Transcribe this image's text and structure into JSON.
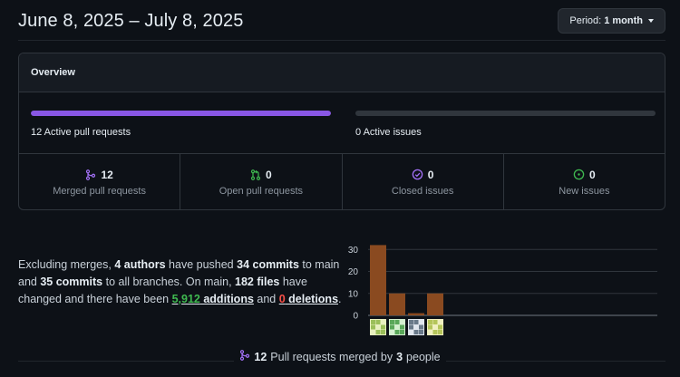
{
  "header": {
    "title": "June 8, 2025 – July 8, 2025",
    "period_prefix": "Period:",
    "period_value": "1 month"
  },
  "overview": {
    "title": "Overview",
    "pr_progress_fraction": 1.0,
    "issues_progress_fraction": 0.0,
    "active_prs_label": "12 Active pull requests",
    "active_issues_label": "0 Active issues",
    "stats": [
      {
        "icon": "git-merge-icon",
        "count": "12",
        "label": "Merged pull requests",
        "color": "#a371f7"
      },
      {
        "icon": "git-pull-request-icon",
        "count": "0",
        "label": "Open pull requests",
        "color": "#3fb950"
      },
      {
        "icon": "issue-closed-icon",
        "count": "0",
        "label": "Closed issues",
        "color": "#a371f7"
      },
      {
        "icon": "issue-opened-icon",
        "count": "0",
        "label": "New issues",
        "color": "#3fb950"
      }
    ]
  },
  "summary": {
    "p1": "Excluding merges, ",
    "authors": "4 authors",
    "p2": " have pushed ",
    "commits_main": "34 commits",
    "p3": " to main and ",
    "commits_all": "35 commits",
    "p4": " to all branches. On main, ",
    "files": "182 files",
    "p5": " have changed and there have been ",
    "additions_num": "5,912",
    "additions_word": " additions",
    "p6": " and ",
    "deletions_num": "0",
    "deletions_word": " deletions",
    "p7": "."
  },
  "chart_data": {
    "type": "bar",
    "categories": [
      "author-1",
      "author-2",
      "author-3",
      "author-4"
    ],
    "values": [
      32,
      10,
      1,
      10
    ],
    "ylim": [
      0,
      33
    ],
    "yticks": [
      "30",
      "20",
      "10",
      "0"
    ],
    "bar_color": "#8a4a20",
    "grid": true
  },
  "merged_summary": {
    "count": "12",
    "text": "Pull requests merged by",
    "people_count": "3",
    "people_word": "people"
  },
  "colors": {
    "accent_purple": "#8957e5",
    "green": "#3fb950",
    "red": "#f85149"
  }
}
